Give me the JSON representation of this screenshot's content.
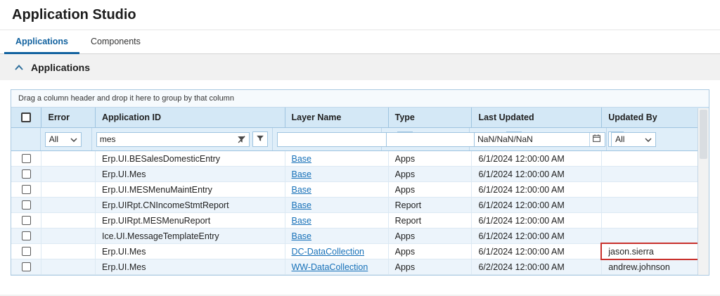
{
  "window": {
    "title": "Application Studio"
  },
  "tabs": {
    "applications": "Applications",
    "components": "Components"
  },
  "panel": {
    "title": "Applications"
  },
  "grid": {
    "group_hint": "Drag a column header and drop it here to group by that column",
    "columns": [
      "Error",
      "Application ID",
      "Layer Name",
      "Type",
      "Last Updated",
      "Updated By"
    ],
    "filters": {
      "error": "All",
      "application_id": "mes",
      "layer_name": "",
      "type": "",
      "last_updated": "NaN/NaN/NaN",
      "updated_by": "All"
    },
    "rows": [
      {
        "application_id": "Erp.UI.BESalesDomesticEntry",
        "layer_name": "Base",
        "type": "Apps",
        "last_updated": "6/1/2024 12:00:00 AM",
        "updated_by": ""
      },
      {
        "application_id": "Erp.UI.Mes",
        "layer_name": "Base",
        "type": "Apps",
        "last_updated": "6/1/2024 12:00:00 AM",
        "updated_by": ""
      },
      {
        "application_id": "Erp.UI.MESMenuMaintEntry",
        "layer_name": "Base",
        "type": "Apps",
        "last_updated": "6/1/2024 12:00:00 AM",
        "updated_by": ""
      },
      {
        "application_id": "Erp.UIRpt.CNIncomeStmtReport",
        "layer_name": "Base",
        "type": "Report",
        "last_updated": "6/1/2024 12:00:00 AM",
        "updated_by": ""
      },
      {
        "application_id": "Erp.UIRpt.MESMenuReport",
        "layer_name": "Base",
        "type": "Report",
        "last_updated": "6/1/2024 12:00:00 AM",
        "updated_by": ""
      },
      {
        "application_id": "Ice.UI.MessageTemplateEntry",
        "layer_name": "Base",
        "type": "Apps",
        "last_updated": "6/1/2024 12:00:00 AM",
        "updated_by": ""
      },
      {
        "application_id": "Erp.UI.Mes",
        "layer_name": "DC-DataCollection",
        "type": "Apps",
        "last_updated": "6/1/2024 12:00:00 AM",
        "updated_by": "jason.sierra"
      },
      {
        "application_id": "Erp.UI.Mes",
        "layer_name": "WW-DataCollection",
        "type": "Apps",
        "last_updated": "6/2/2024 12:00:00 AM",
        "updated_by": "andrew.johnson"
      }
    ]
  },
  "colors": {
    "accent": "#12629f",
    "link": "#1670b8",
    "highlight": "#c9302c",
    "grid_header_bg": "#d4e8f6"
  }
}
